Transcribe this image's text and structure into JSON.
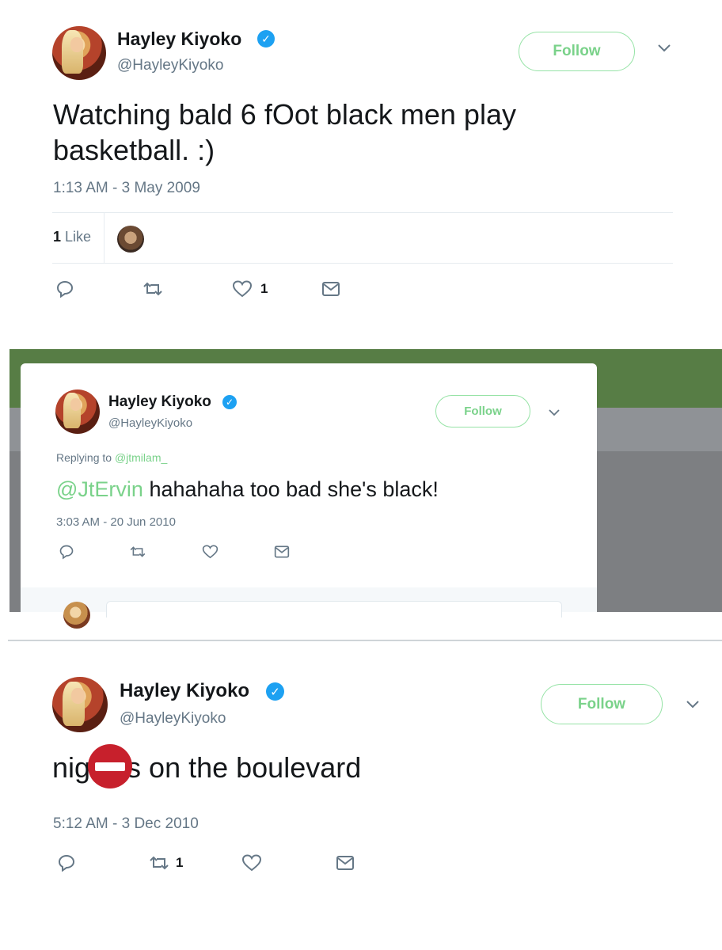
{
  "tweet1": {
    "name": "Hayley Kiyoko",
    "handle": "@HayleyKiyoko",
    "follow_label": "Follow",
    "text": "Watching bald 6 fOot black men play basketball. :)",
    "timestamp": "1:13 AM - 3 May 2009",
    "likes_count": "1",
    "likes_label": "Like",
    "actions": {
      "reply_icon": "reply-icon",
      "retweet_icon": "retweet-icon",
      "like_icon": "heart-icon",
      "like_count": "1",
      "dm_icon": "envelope-icon"
    }
  },
  "tweet2": {
    "name": "Hayley Kiyoko",
    "handle": "@HayleyKiyoko",
    "follow_label": "Follow",
    "replying_prefix": "Replying to",
    "replying_to": "@jtmilam_",
    "mention": "@JtErvin",
    "text": " hahahaha too bad she's black!",
    "timestamp": "3:03 AM - 20 Jun 2010"
  },
  "tweet3": {
    "name": "Hayley Kiyoko",
    "handle": "@HayleyKiyoko",
    "follow_label": "Follow",
    "text_start": "nig",
    "text_end": "s on the boulevard",
    "timestamp": "5:12 AM - 3 Dec 2010",
    "retweet_count": "1"
  },
  "colors": {
    "verified_blue": "#1da1f2",
    "follow_green": "#7ad28a",
    "muted_gray": "#657786",
    "backdrop_green": "#577d45",
    "no_entry_red": "#c7202c"
  }
}
